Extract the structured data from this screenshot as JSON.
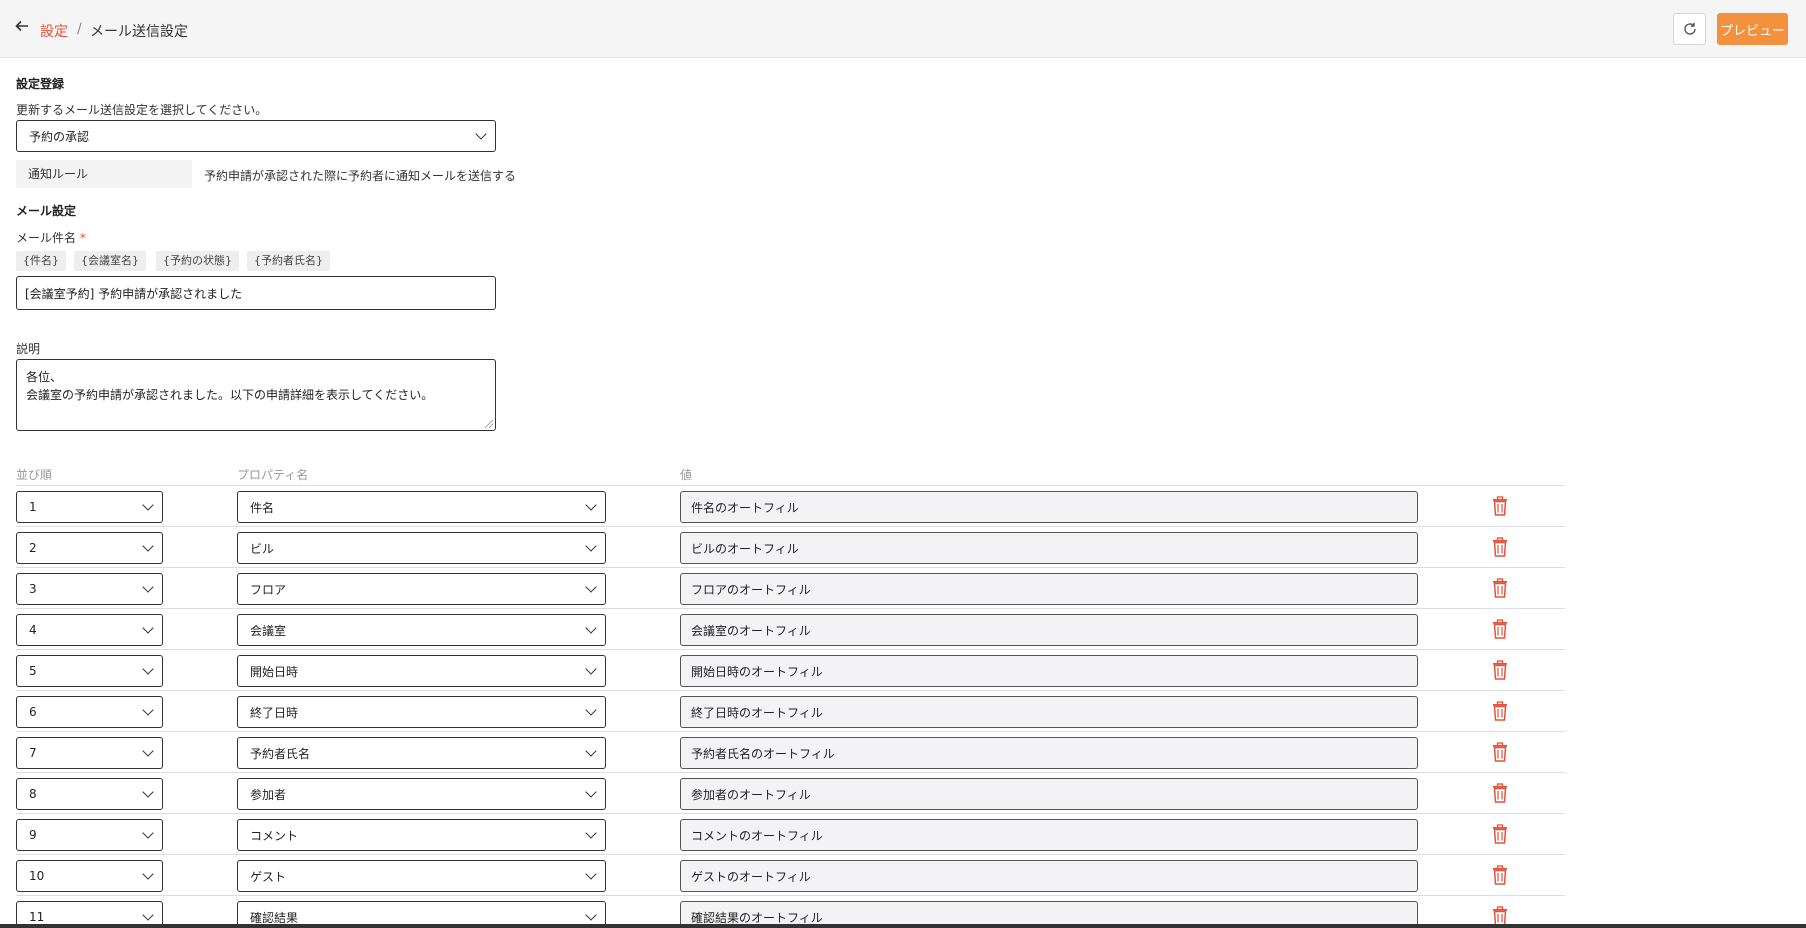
{
  "header": {
    "back_icon": "arrow-left-icon",
    "breadcrumb_parent": "設定",
    "breadcrumb_separator": "/",
    "breadcrumb_current": "メール送信設定",
    "refresh_icon": "refresh-icon",
    "preview_label": "プレビュー"
  },
  "registration": {
    "title": "設定登録",
    "select_hint": "更新するメール送信設定を選択してください。",
    "selected_setting": "予約の承認",
    "rule_label": "通知ルール",
    "rule_description": "予約申請が承認された際に予約者に通知メールを送信する"
  },
  "mail": {
    "title": "メール設定",
    "subject_label": "メール件名",
    "required_mark": "*",
    "chips": [
      "{件名}",
      "{会議室名}",
      "{予約の状態}",
      "{予約者氏名}"
    ],
    "subject_value": "[会議室予約] 予約申請が承認されました",
    "description_label": "説明",
    "description_line1": "各位、",
    "description_line2": "会議室の予約申請が承認されました。以下の申請詳細を表示してください。"
  },
  "table": {
    "headers": {
      "order": "並び順",
      "property": "プロパティ名",
      "value": "値"
    },
    "rows": [
      {
        "order": "1",
        "property": "件名",
        "value": "件名のオートフィル"
      },
      {
        "order": "2",
        "property": "ビル",
        "value": "ビルのオートフィル"
      },
      {
        "order": "3",
        "property": "フロア",
        "value": "フロアのオートフィル"
      },
      {
        "order": "4",
        "property": "会議室",
        "value": "会議室のオートフィル"
      },
      {
        "order": "5",
        "property": "開始日時",
        "value": "開始日時のオートフィル"
      },
      {
        "order": "6",
        "property": "終了日時",
        "value": "終了日時のオートフィル"
      },
      {
        "order": "7",
        "property": "予約者氏名",
        "value": "予約者氏名のオートフィル"
      },
      {
        "order": "8",
        "property": "参加者",
        "value": "参加者のオートフィル"
      },
      {
        "order": "9",
        "property": "コメント",
        "value": "コメントのオートフィル"
      },
      {
        "order": "10",
        "property": "ゲスト",
        "value": "ゲストのオートフィル"
      },
      {
        "order": "11",
        "property": "確認結果",
        "value": "確認結果のオートフィル"
      }
    ]
  },
  "colors": {
    "accent": "#e5513a",
    "preview_button": "#f3913f",
    "trash": "#e5513a"
  }
}
